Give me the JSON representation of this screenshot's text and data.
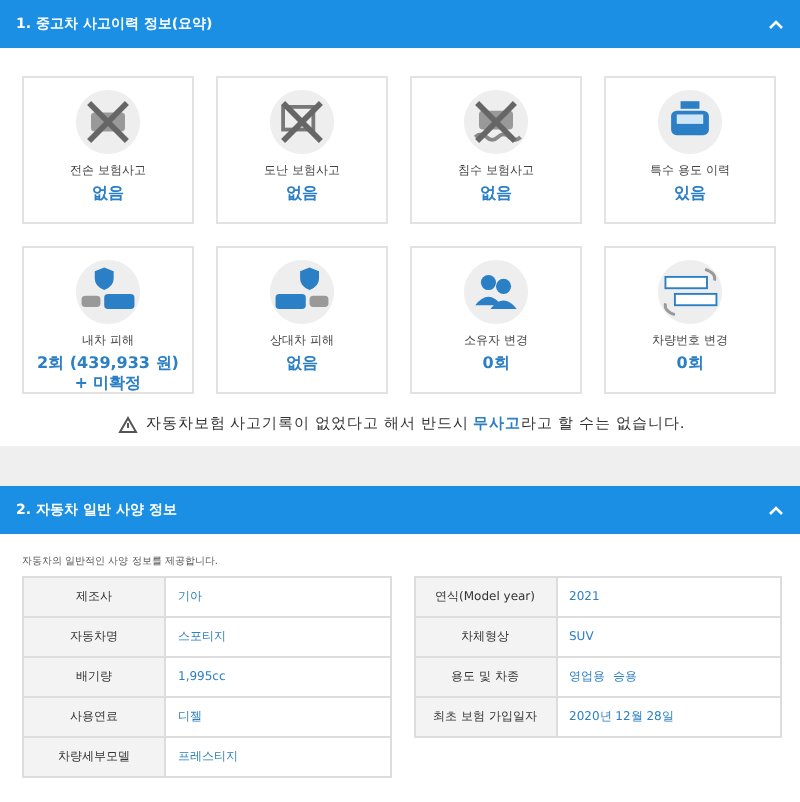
{
  "sections": [
    {
      "title": "1. 중고차 사고이력 정보(요약)",
      "expanded": true
    },
    {
      "title": "2. 자동차 일반 사양 정보",
      "expanded": true
    }
  ],
  "cards": [
    {
      "label": "전손 보험사고",
      "value": "없음"
    },
    {
      "label": "도난 보험사고",
      "value": "없음"
    },
    {
      "label": "침수 보험사고",
      "value": "없음"
    },
    {
      "label": "특수 용도 이력",
      "value": "있음"
    },
    {
      "label": "내차 피해",
      "value": "2회 (439,933 원) + 미확정"
    },
    {
      "label": "상대차 피해",
      "value": "없음"
    },
    {
      "label": "소유자 변경",
      "value": "0회"
    },
    {
      "label": "차량번호 변경",
      "value": "0회"
    }
  ],
  "notice": "자동차보험 사고기록이 없었다고 해서 반드시 **무사고**라고 할 수는 없습니다.",
  "spec_intro": "자동차의 일반적인 사양 정보를 제공합니다.",
  "spec_left": [
    {
      "label": "제조사",
      "value": "기아"
    },
    {
      "label": "자동차명",
      "value": "스포티지"
    },
    {
      "label": "배기량",
      "value": "1,995cc"
    },
    {
      "label": "사용연료",
      "value": "디젤"
    },
    {
      "label": "차량세부모델",
      "value": "프레스티지"
    }
  ],
  "spec_right": [
    {
      "label": "연식(Model year)",
      "value": "2021"
    },
    {
      "label": "차체형상",
      "value": "SUV"
    },
    {
      "label": "용도 및 차종",
      "value": "영업용  승용"
    },
    {
      "label": "최초 보험 가입일자",
      "value": "2020년 12월 28일"
    }
  ]
}
